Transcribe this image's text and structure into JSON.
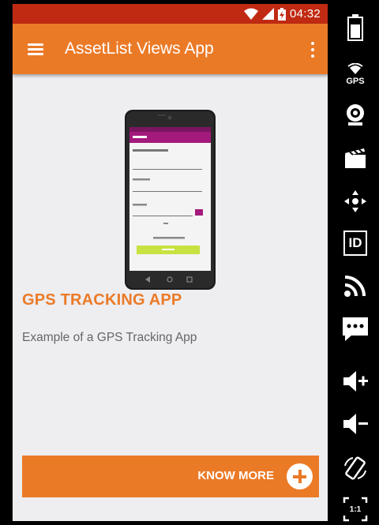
{
  "status_bar": {
    "time": "04:32",
    "icons": [
      "wifi-icon",
      "signal-icon",
      "battery-charging-icon"
    ],
    "color": "#c02a13"
  },
  "toolbar": {
    "title": "AssetList Views App",
    "menu_icon": "hamburger-menu-icon",
    "overflow_icon": "overflow-menu-icon",
    "color": "#eb7a27"
  },
  "card": {
    "image_icon": "phone-screenshot-image",
    "title": "GPS TRACKING APP",
    "description": "Example of a GPS Tracking App",
    "button_label": "KNOW MORE",
    "button_icon": "plus-circle-icon",
    "accent": "#eb7a27"
  },
  "side_panel": {
    "buttons": [
      {
        "icon": "battery-icon"
      },
      {
        "icon": "gps-icon",
        "label": "GPS"
      },
      {
        "icon": "camera-icon"
      },
      {
        "icon": "clapperboard-icon"
      },
      {
        "icon": "dpad-icon"
      },
      {
        "icon": "id-icon",
        "label": "ID"
      },
      {
        "icon": "cast-icon"
      },
      {
        "icon": "message-icon"
      },
      {
        "icon": "volume-up-icon"
      },
      {
        "icon": "volume-down-icon"
      },
      {
        "icon": "rotate-icon"
      },
      {
        "icon": "fullscreen-icon",
        "label": "1:1"
      }
    ]
  }
}
